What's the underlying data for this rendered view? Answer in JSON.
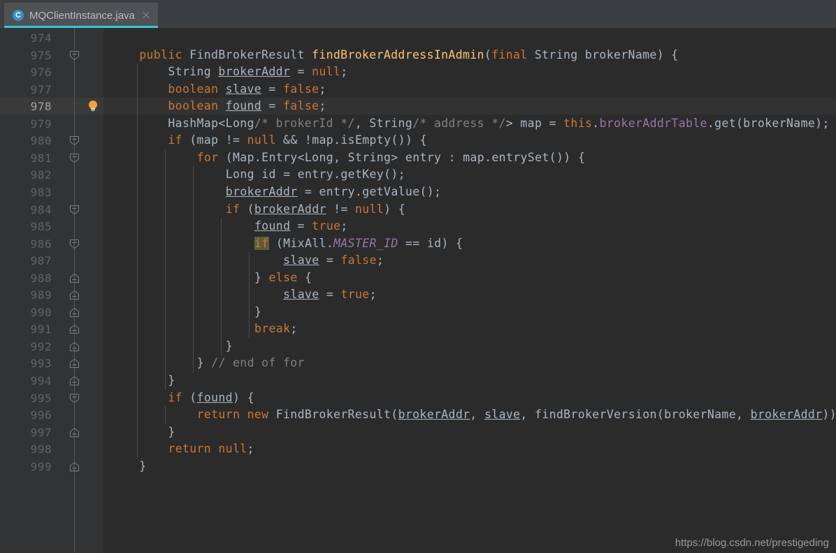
{
  "window": {
    "background": "#2b2b2b",
    "gutter_background": "#313335",
    "tabbar_background": "#3c3f41"
  },
  "tab": {
    "label": "MQClientInstance.java",
    "icon": "C",
    "icon_name": "java-class-icon",
    "close_label": "×",
    "active_underline_color": "#32c8d8",
    "active": true
  },
  "editor": {
    "language": "Java",
    "first_line": 974,
    "last_line": 999,
    "current_line": 978,
    "caret_line": 978,
    "colors": {
      "keyword": "#cc7832",
      "comment": "#808080",
      "field": "#9876aa",
      "method": "#ffc66d",
      "static_field": "#9876aa",
      "default_text": "#a9b7c6",
      "line_number": "#606366",
      "current_line_number": "#a4a3a3",
      "selection_highlight": "#5c5c3d"
    },
    "line_numbers": [
      974,
      975,
      976,
      977,
      978,
      979,
      980,
      981,
      982,
      983,
      984,
      985,
      986,
      987,
      988,
      989,
      990,
      991,
      992,
      993,
      994,
      995,
      996,
      997,
      998,
      999
    ],
    "lines": [
      {
        "n": 974,
        "text": ""
      },
      {
        "n": 975,
        "text": "    public FindBrokerResult findBrokerAddressInAdmin(final String brokerName) {"
      },
      {
        "n": 976,
        "text": "        String brokerAddr = null;"
      },
      {
        "n": 977,
        "text": "        boolean slave = false;"
      },
      {
        "n": 978,
        "text": "        boolean found = false;"
      },
      {
        "n": 979,
        "text": "        HashMap<Long/* brokerId */, String/* address */> map = this.brokerAddrTable.get(brokerName);"
      },
      {
        "n": 980,
        "text": "        if (map != null && !map.isEmpty()) {"
      },
      {
        "n": 981,
        "text": "            for (Map.Entry<Long, String> entry : map.entrySet()) {"
      },
      {
        "n": 982,
        "text": "                Long id = entry.getKey();"
      },
      {
        "n": 983,
        "text": "                brokerAddr = entry.getValue();"
      },
      {
        "n": 984,
        "text": "                if (brokerAddr != null) {"
      },
      {
        "n": 985,
        "text": "                    found = true;"
      },
      {
        "n": 986,
        "text": "                    if (MixAll.MASTER_ID == id) {"
      },
      {
        "n": 987,
        "text": "                        slave = false;"
      },
      {
        "n": 988,
        "text": "                    } else {"
      },
      {
        "n": 989,
        "text": "                        slave = true;"
      },
      {
        "n": 990,
        "text": "                    }"
      },
      {
        "n": 991,
        "text": "                    break;"
      },
      {
        "n": 992,
        "text": "                }"
      },
      {
        "n": 993,
        "text": "            } // end of for"
      },
      {
        "n": 994,
        "text": "        }"
      },
      {
        "n": 995,
        "text": "        if (found) {"
      },
      {
        "n": 996,
        "text": "            return new FindBrokerResult(brokerAddr, slave, findBrokerVersion(brokerName, brokerAddr));"
      },
      {
        "n": 997,
        "text": "        }"
      },
      {
        "n": 998,
        "text": "        return null;"
      },
      {
        "n": 999,
        "text": "    }"
      }
    ],
    "gutter_markers": {
      "fold_start_lines": [
        975,
        980,
        981,
        984,
        986,
        995
      ],
      "fold_end_lines": [
        988,
        989,
        990,
        991,
        992,
        993,
        994,
        997,
        999
      ],
      "bulb_line": 978,
      "bulb_name": "intention-bulb-icon"
    },
    "caret_highlight_token": "if",
    "caret_highlight_line": 986
  },
  "watermark": {
    "text": "https://blog.csdn.net/prestigeding"
  }
}
